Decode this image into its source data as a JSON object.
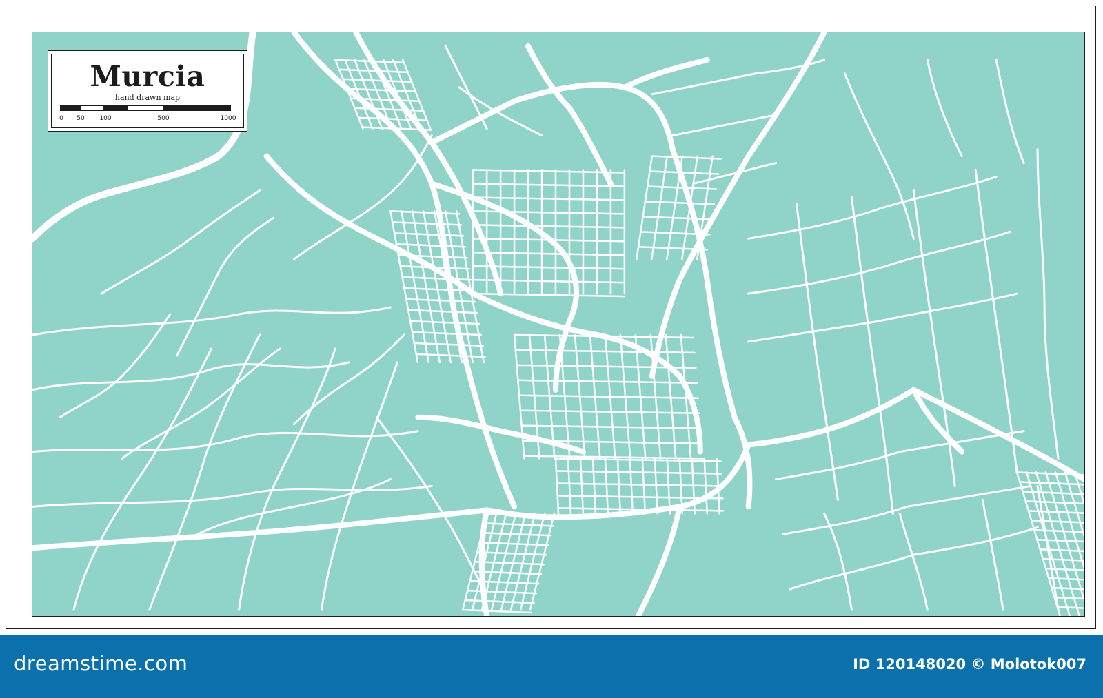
{
  "map": {
    "title": "Murcia",
    "subtitle": "hand drawn map",
    "scale_labels": [
      "0",
      "50",
      "100",
      "500",
      "1000"
    ],
    "colors": {
      "land": "#8fd3c9",
      "roads": "#ffffff",
      "frame": "#1c1c1c"
    }
  },
  "footer": {
    "brand": "dreamstime.com",
    "image_id": "ID 120148020 © Molotok007",
    "background": "#0a71ad"
  }
}
